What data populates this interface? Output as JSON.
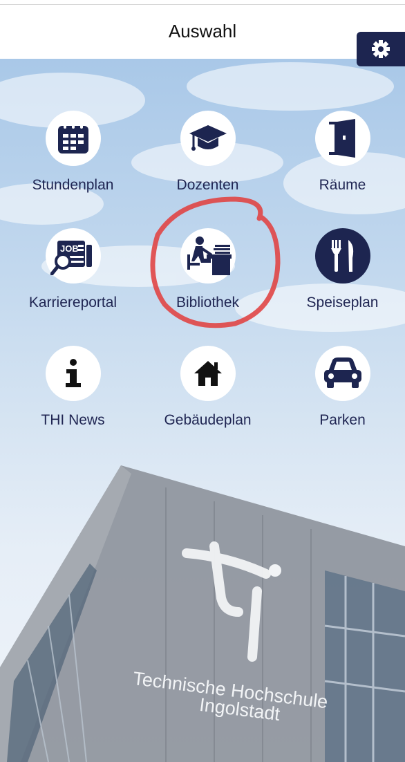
{
  "header": {
    "title": "Auswahl",
    "settings_icon": "gear-icon"
  },
  "tiles": [
    {
      "label": "Stundenplan",
      "icon": "calendar-icon"
    },
    {
      "label": "Dozenten",
      "icon": "graduation-cap-icon"
    },
    {
      "label": "Räume",
      "icon": "door-icon"
    },
    {
      "label": "Karriereportal",
      "icon": "job-search-icon"
    },
    {
      "label": "Bibliothek",
      "icon": "library-reader-icon"
    },
    {
      "label": "Speiseplan",
      "icon": "fork-knife-icon"
    },
    {
      "label": "THI News",
      "icon": "info-icon"
    },
    {
      "label": "Gebäudeplan",
      "icon": "home-icon"
    },
    {
      "label": "Parken",
      "icon": "car-icon"
    }
  ],
  "building_sign": {
    "line1": "Technische Hochschule",
    "line2": "Ingolstadt"
  },
  "colors": {
    "navy": "#1d2550",
    "annotation_red": "#e04545"
  }
}
